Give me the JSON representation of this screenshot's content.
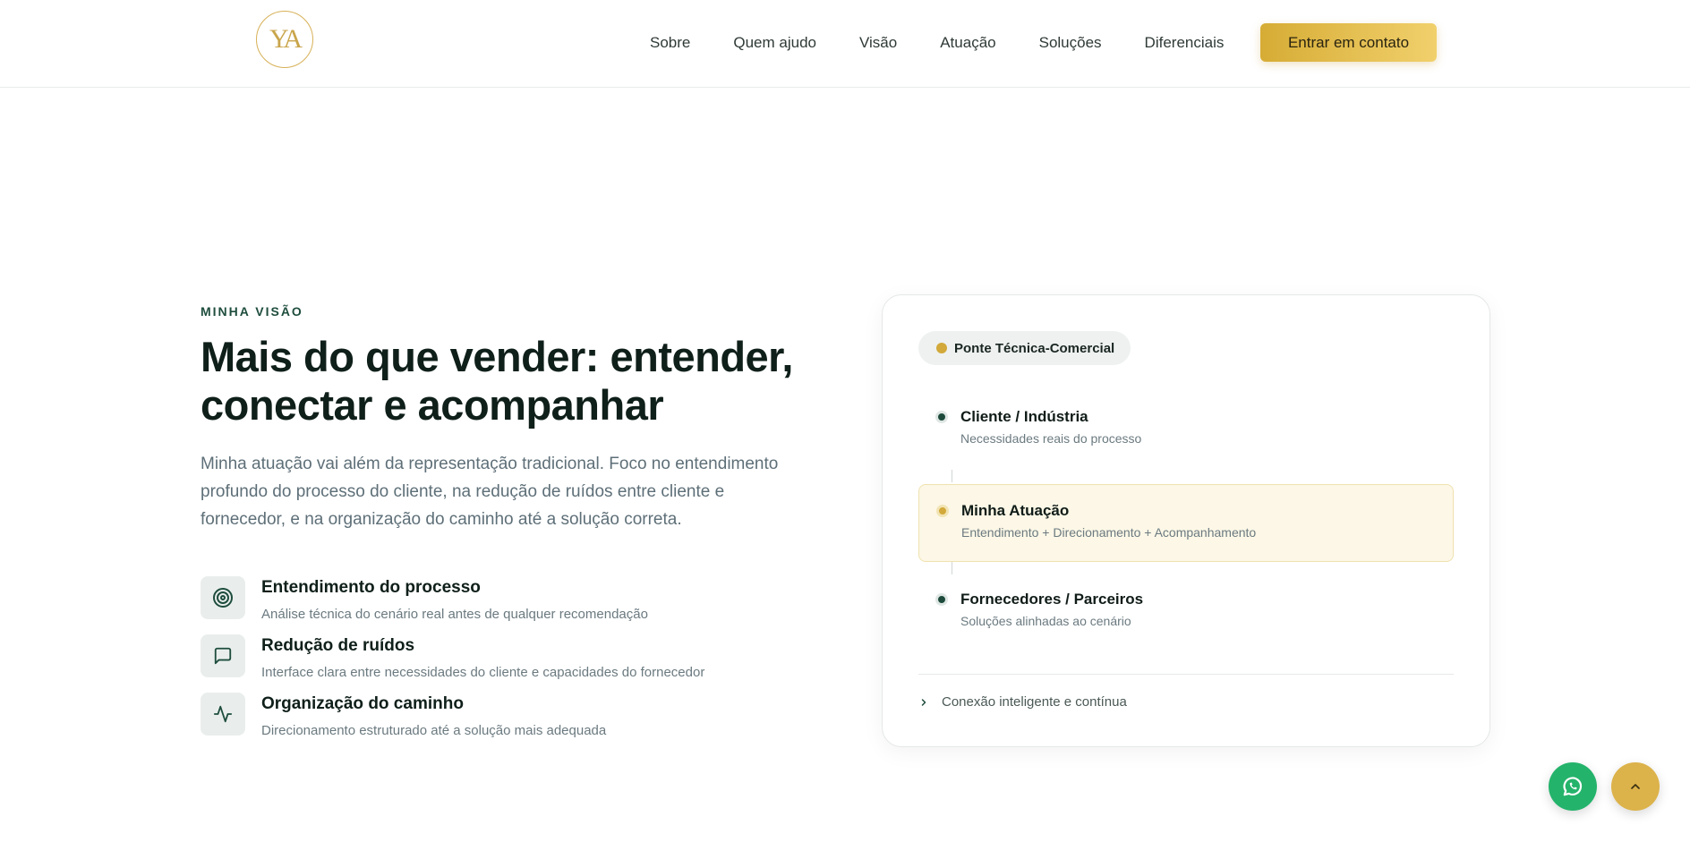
{
  "header": {
    "logo_text": "YA",
    "nav": [
      "Sobre",
      "Quem ajudo",
      "Visão",
      "Atuação",
      "Soluções",
      "Diferenciais"
    ],
    "cta_label": "Entrar em contato"
  },
  "hero": {
    "eyebrow": "MINHA VISÃO",
    "title": "Mais do que vender: entender, conectar e acompanhar",
    "lead": "Minha atuação vai além da representação tradicional. Foco no entendimento profundo do processo do cliente, na redução de ruídos entre cliente e fornecedor, e na organização do caminho até a solução correta.",
    "features": [
      {
        "icon": "target-icon",
        "title": "Entendimento do processo",
        "desc": "Análise técnica do cenário real antes de qualquer recomendação"
      },
      {
        "icon": "message-icon",
        "title": "Redução de ruídos",
        "desc": "Interface clara entre necessidades do cliente e capacidades do fornecedor"
      },
      {
        "icon": "activity-icon",
        "title": "Organização do caminho",
        "desc": "Direcionamento estruturado até a solução mais adequada"
      }
    ]
  },
  "card": {
    "badge": "Ponte Técnica-Comercial",
    "nodes": [
      {
        "title": "Cliente / Indústria",
        "desc": "Necessidades reais do processo"
      },
      {
        "title": "Minha Atuação",
        "desc": "Entendimento + Direcionamento + Acompanhamento"
      },
      {
        "title": "Fornecedores / Parceiros",
        "desc": "Soluções alinhadas ao cenário"
      }
    ],
    "footer_link": "Conexão inteligente e contínua"
  },
  "colors": {
    "accent_gold": "#d6ac35",
    "brand_green": "#1e4d3d",
    "whatsapp_green": "#24b36b"
  }
}
